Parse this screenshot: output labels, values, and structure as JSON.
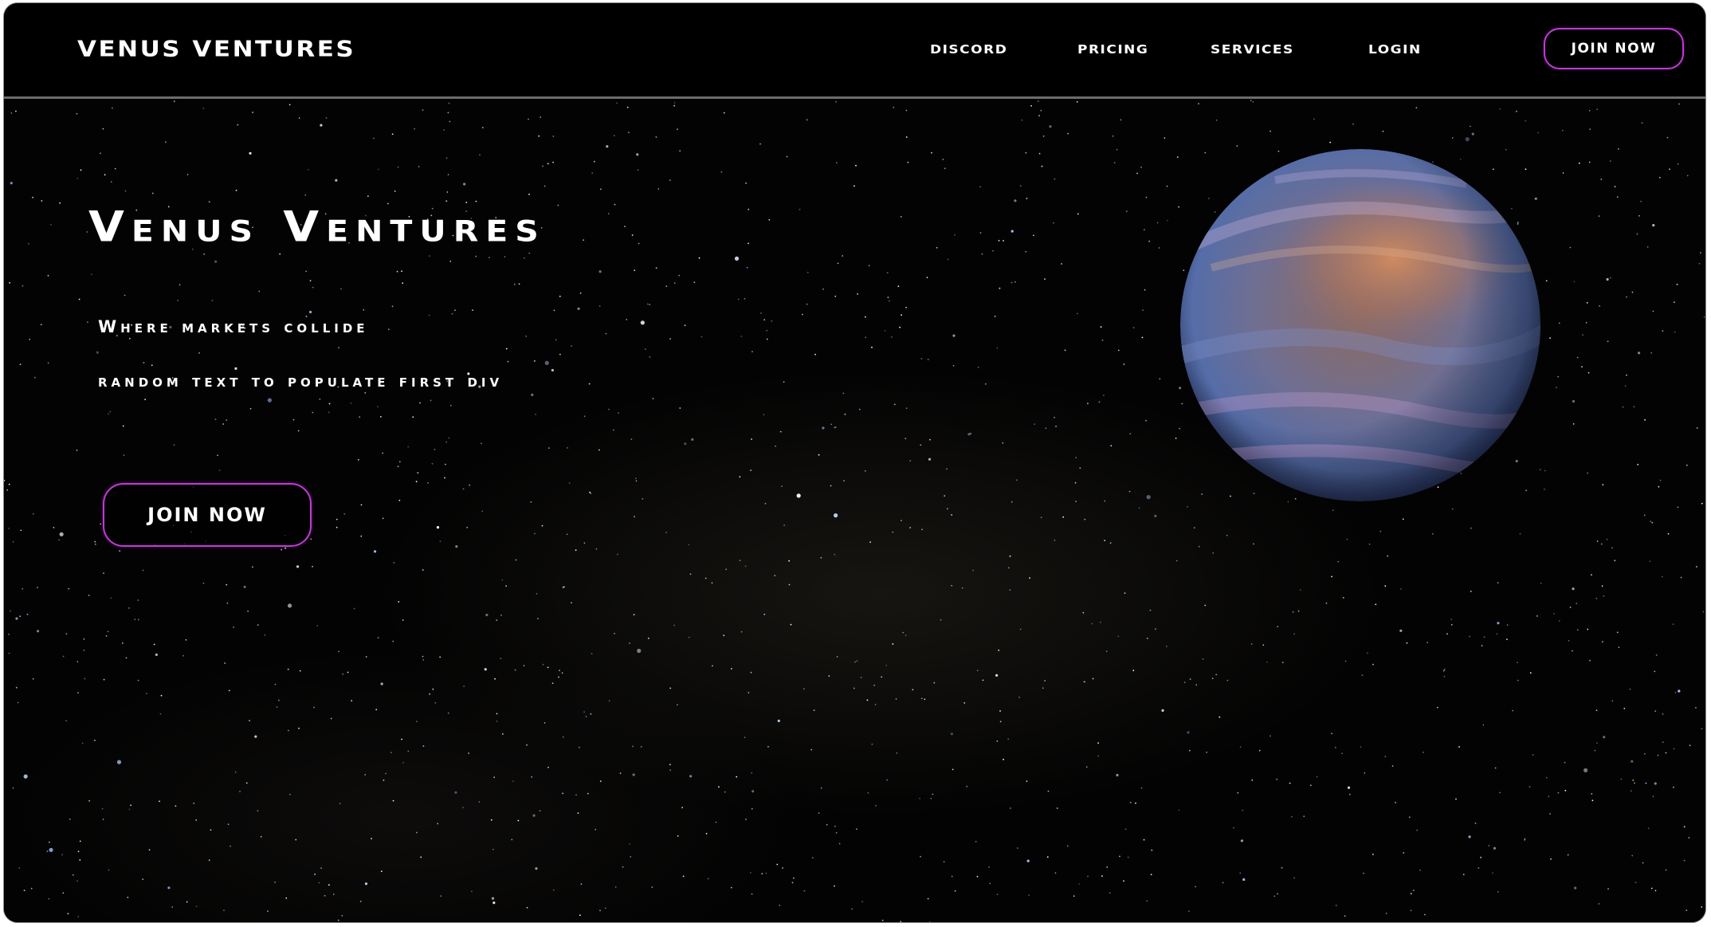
{
  "navbar": {
    "brand": "VENUS VENTURES",
    "links": [
      {
        "label": "DISCORD"
      },
      {
        "label": "PRICING"
      },
      {
        "label": "SERVICES"
      },
      {
        "label": "LOGIN"
      }
    ],
    "join_label": "JOIN NOW"
  },
  "hero": {
    "title": "Venus Ventures",
    "tagline": "Where markets collide",
    "filler_text": "random text  to populate first div",
    "join_label": "JOIN NOW",
    "planet_icon": "venus-planet-image"
  },
  "colors": {
    "background": "#000000",
    "accent_border": "#c13ad6",
    "text": "#ffffff",
    "divider": "#6c6c6c"
  }
}
